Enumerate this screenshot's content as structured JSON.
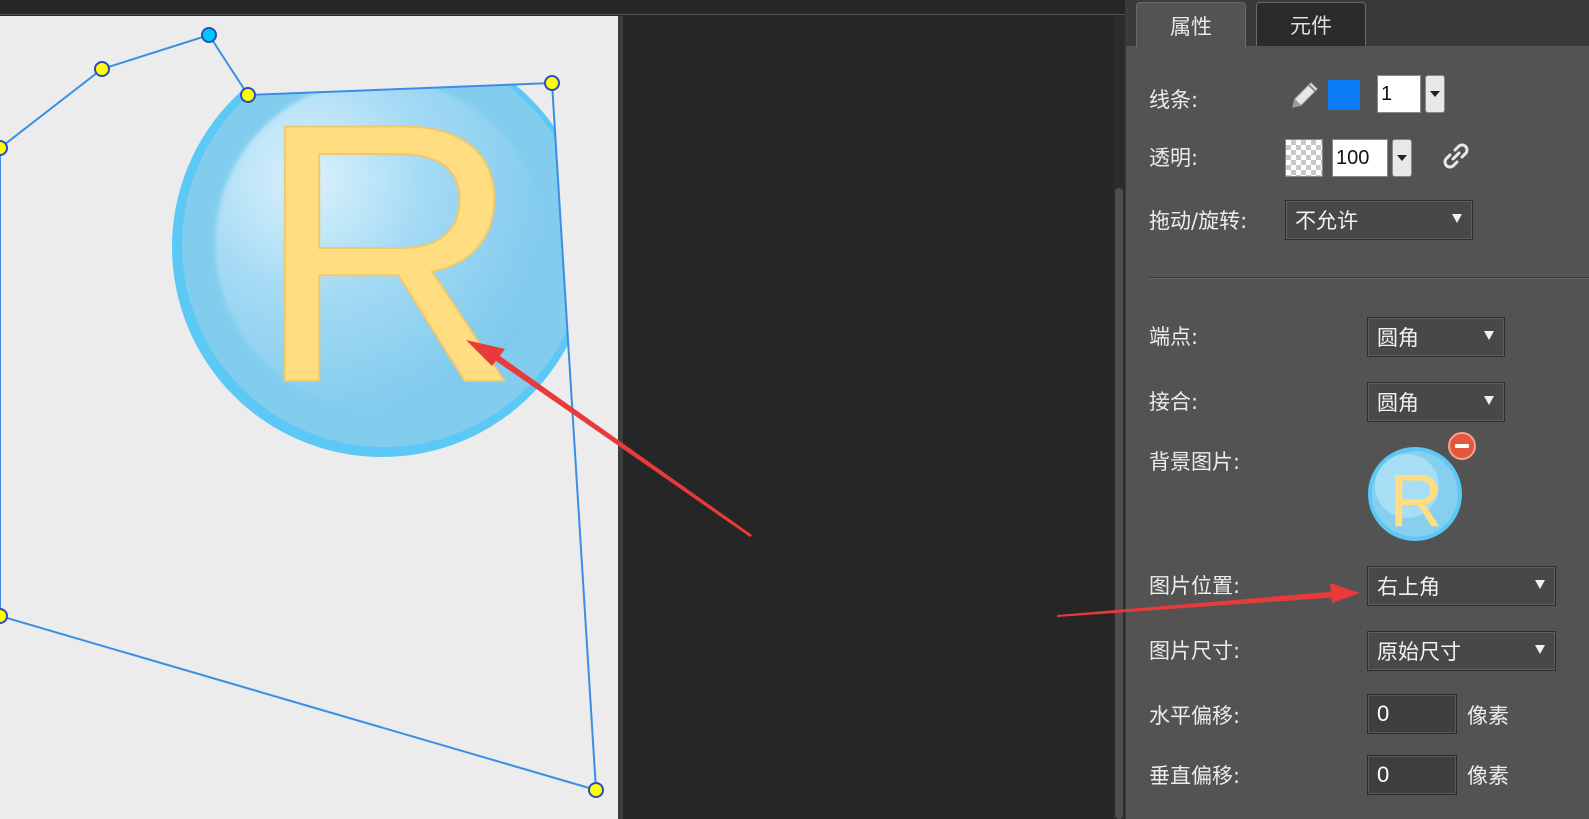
{
  "tabs": {
    "properties": "属性",
    "components": "元件"
  },
  "props": {
    "line_label": "线条:",
    "line_width": "1",
    "line_color": "#0a7cf7",
    "opacity_label": "透明:",
    "opacity_value": "100",
    "drag_label": "拖动/旋转:",
    "drag_value": "不允许",
    "cap_label": "端点:",
    "cap_value": "圆角",
    "join_label": "接合:",
    "join_value": "圆角",
    "bg_image_label": "背景图片:",
    "bg_image_letter": "R",
    "image_pos_label": "图片位置:",
    "image_pos_value": "右上角",
    "image_size_label": "图片尺寸:",
    "image_size_value": "原始尺寸",
    "h_offset_label": "水平偏移:",
    "h_offset_value": "0",
    "h_offset_unit": "像素",
    "v_offset_label": "垂直偏移:",
    "v_offset_value": "0",
    "v_offset_unit": "像素"
  },
  "canvas": {
    "logo_letter": "R",
    "shape_stroke": "#3a8ee6",
    "handle_fill": "#ffff00",
    "handle_active_fill": "#00c8ff"
  },
  "icons": {
    "pencil": "pencil-icon",
    "link": "link-icon",
    "remove": "remove-icon"
  },
  "annotation_color": "#e83a3a"
}
